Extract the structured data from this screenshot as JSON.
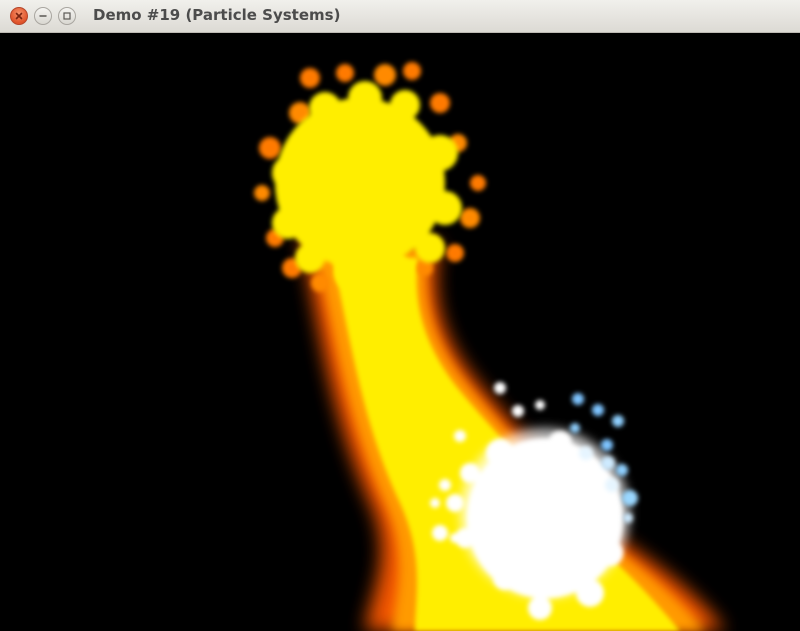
{
  "window": {
    "title": "Demo #19 (Particle Systems)"
  },
  "titlebar_buttons": [
    {
      "name": "close",
      "icon": "close-icon",
      "color": "#e0532a"
    },
    {
      "name": "minimize",
      "icon": "minimize-icon",
      "color": "#d9d7d1"
    },
    {
      "name": "maximize",
      "icon": "maximize-icon",
      "color": "#d9d7d1"
    }
  ],
  "scene": {
    "background": "#000000",
    "fire_colors": [
      "#ffff00",
      "#ff9a00",
      "#ff5a00"
    ],
    "spark_colors": [
      "#ffffff",
      "#8fd0ff"
    ]
  }
}
